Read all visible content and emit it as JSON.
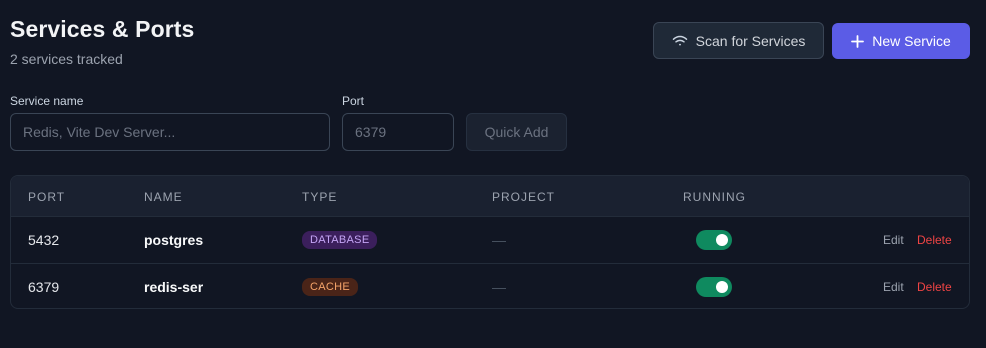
{
  "header": {
    "title": "Services & Ports",
    "subtitle": "2 services tracked",
    "scan_button": {
      "label": "Scan for Services",
      "icon": "wifi-icon"
    },
    "new_button": {
      "label": "New Service",
      "icon": "plus-icon"
    }
  },
  "quick_add": {
    "service_label": "Service name",
    "service_placeholder": "Redis, Vite Dev Server...",
    "service_value": "",
    "port_label": "Port",
    "port_placeholder": "6379",
    "port_value": "",
    "button_label": "Quick Add"
  },
  "table": {
    "columns": [
      "Port",
      "Name",
      "Type",
      "Project",
      "Running"
    ],
    "rows": [
      {
        "port": "5432",
        "name": "postgres",
        "type": "DATABASE",
        "project": "—",
        "running": true,
        "edit": "Edit",
        "delete": "Delete"
      },
      {
        "port": "6379",
        "name": "redis-ser",
        "type": "CACHE",
        "project": "—",
        "running": true,
        "edit": "Edit",
        "delete": "Delete"
      }
    ]
  },
  "colors": {
    "background": "#111623",
    "accent": "#5b5ce6",
    "toggle_on": "#0f8a5f",
    "database_badge_bg": "#3b1f5c",
    "database_badge_text": "#c4a5f5",
    "cache_badge_bg": "#4a2418",
    "cache_badge_text": "#f5a46a",
    "delete": "#ef4444"
  }
}
